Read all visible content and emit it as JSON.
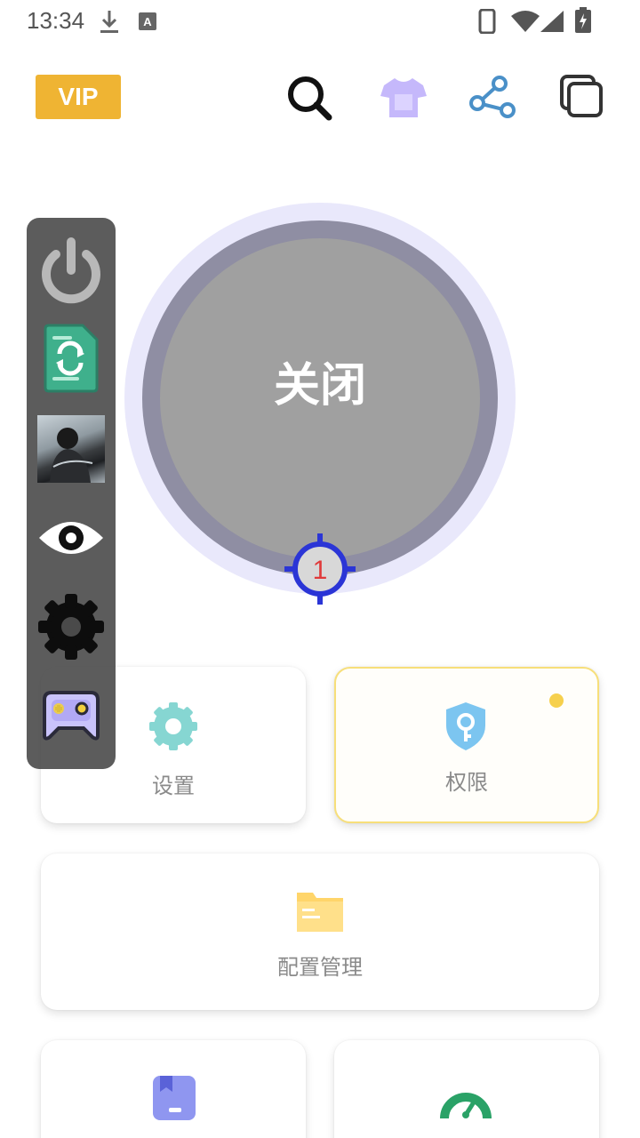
{
  "status_bar": {
    "time": "13:34",
    "icons": [
      "download-icon",
      "text-a-icon",
      "phone-icon",
      "wifi-icon",
      "signal-icon",
      "battery-charging-icon"
    ]
  },
  "header": {
    "vip_label": "VIP",
    "icons": [
      "search-icon",
      "tshirt-icon",
      "share-icon",
      "copy-icon"
    ]
  },
  "power": {
    "status": "关闭",
    "marker_number": "1"
  },
  "side_panel": {
    "items": [
      "power-icon",
      "file-sync-icon",
      "avatar-photo",
      "eye-icon",
      "gear-icon",
      "gamepad-icon"
    ]
  },
  "cards": {
    "settings": "设置",
    "permissions": "权限",
    "config": "配置管理"
  },
  "colors": {
    "vip": "#efb433",
    "ring_outer": "#e9e8fb",
    "ring_mid": "#8f8ea3",
    "ring_inner": "#a0a0a0",
    "crosshair": "#2b35d6",
    "marker_number": "#e03a3a",
    "settings_icon": "#86d6d2",
    "permission_icon": "#7cc5f0",
    "folder_icon": "#ffe08a",
    "bookmark_icon": "#8f96f0",
    "gauge_icon": "#2aa267"
  }
}
